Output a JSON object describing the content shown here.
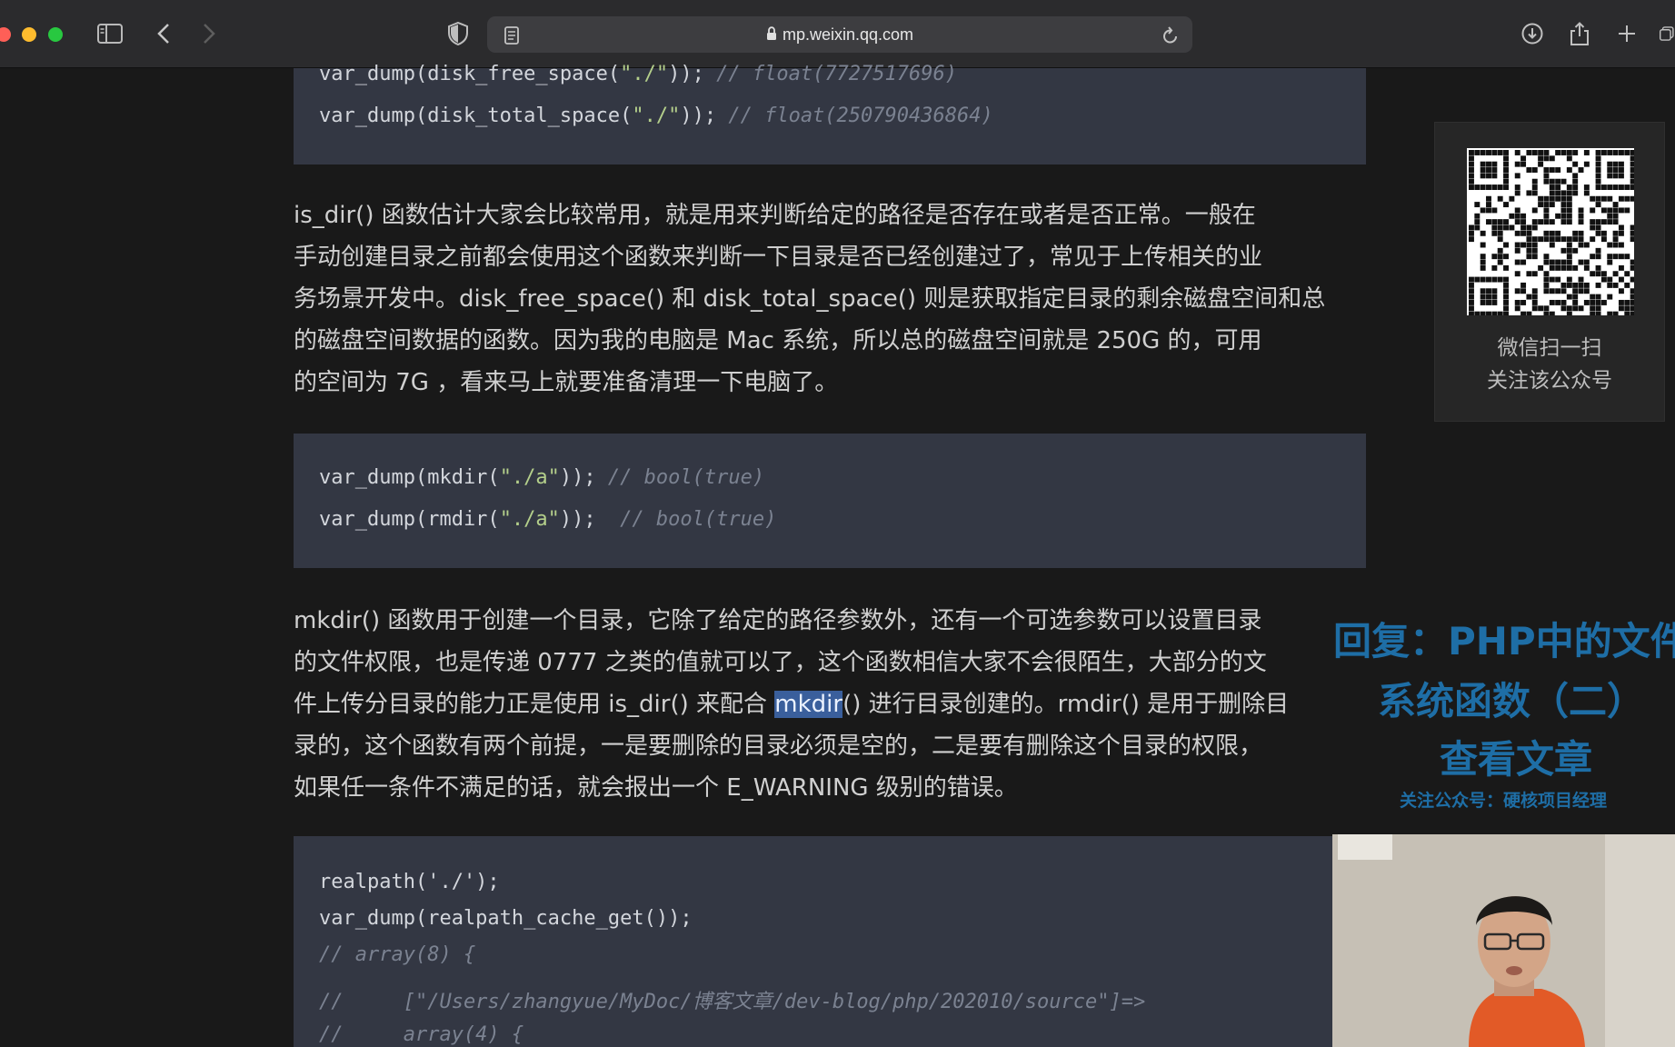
{
  "browser": {
    "url": "mp.weixin.qq.com",
    "lock_icon": "lock-icon",
    "reader_icon": "reader-icon",
    "shield_icon": "shield-icon"
  },
  "code_block_1": {
    "lines": [
      {
        "prefix": "var_dump(disk_free_space(",
        "str": "\"./\"",
        "suffix": ")); ",
        "comment": "// float(7727517696)"
      },
      {
        "prefix": "var_dump(disk_total_space(",
        "str": "\"./\"",
        "suffix": ")); ",
        "comment": "// float(250790436864)"
      }
    ]
  },
  "paragraph_1": {
    "lines": [
      "is_dir() 函数估计大家会比较常用，就是用来判断给定的路径是否存在或者是否正常。一般在",
      "手动创建目录之前都会使用这个函数来判断一下目录是否已经创建过了，常见于上传相关的业",
      "务场景开发中。disk_free_space() 和 disk_total_space() 则是获取指定目录的剩余磁盘空间和总",
      "的磁盘空间数据的函数。因为我的电脑是 Mac 系统，所以总的磁盘空间就是 250G 的，可用",
      "的空间为 7G ，看来马上就要准备清理一下电脑了。"
    ]
  },
  "code_block_2": {
    "lines": [
      {
        "prefix": "var_dump(mkdir(",
        "str": "\"./a\"",
        "suffix": ")); ",
        "comment": "// bool(true)"
      },
      {
        "prefix": "var_dump(rmdir(",
        "str": "\"./a\"",
        "suffix": "));  ",
        "comment": "// bool(true)"
      }
    ]
  },
  "paragraph_2": {
    "lines": [
      "mkdir() 函数用于创建一个目录，它除了给定的路径参数外，还有一个可选参数可以设置目录",
      "的文件权限，也是传递 0777 之类的值就可以了，这个函数相信大家不会很陌生，大部分的文",
      "录的，这个函数有两个前提，一是要删除的目录必须是空的，二是要有删除这个目录的权限，",
      "如果任一条件不满足的话，就会报出一个 E_WARNING 级别的错误。"
    ],
    "line3_before": "件上传分目录的能力正是使用 is_dir() 来配合 ",
    "line3_highlight": "mkdir",
    "line3_after": "() 进行目录创建的。rmdir() 是用于删除目"
  },
  "code_block_3": {
    "lines": [
      "realpath('./');",
      "var_dump(realpath_cache_get());",
      "// array(8) {",
      "//     [\"/Users/zhangyue/MyDoc/博客文章/dev-blog/php/202010/source\"]=>",
      "//     array(4) {"
    ]
  },
  "qr_panel": {
    "caption_line1": "微信扫一扫",
    "caption_line2": "关注该公众号"
  },
  "overlay": {
    "line1": "回复：PHP中的文件",
    "line2": "系统函数（二）",
    "line3": "查看文章",
    "line4": "关注公众号：硬核项目经理"
  },
  "colors": {
    "accent_overlay": "#1e6ea6",
    "code_background": "#333743",
    "highlight": "#3a5f9c"
  }
}
